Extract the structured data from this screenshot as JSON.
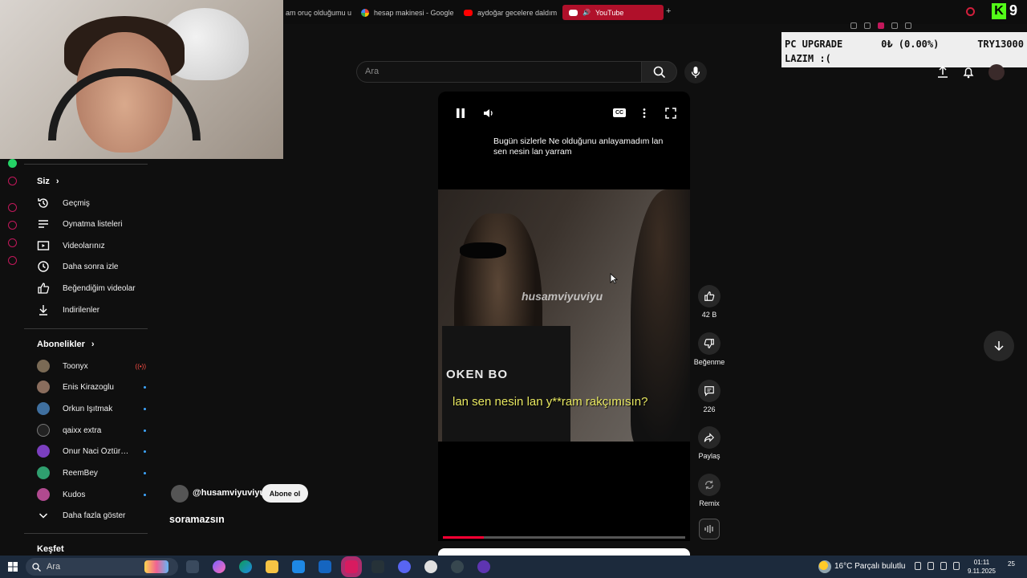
{
  "browser": {
    "tabs": [
      {
        "label": "am oruç olduğumu un",
        "icon": "tab-icon"
      },
      {
        "label": "hesap makinesi - Google",
        "icon": "google-icon"
      },
      {
        "label": "aydoğar gecelere daldım",
        "icon": "youtube-icon"
      },
      {
        "label": "YouTube",
        "icon": "youtube-icon",
        "active": true
      }
    ],
    "new_tab": "+",
    "kick_count": "9"
  },
  "donation": {
    "line1_left": "PC UPGRADE",
    "line1_mid": "0₺ (0.00%)",
    "line1_right": "TRY13000",
    "line2": "LAZIM :("
  },
  "search": {
    "placeholder": "Ara"
  },
  "sidebar": {
    "you": {
      "heading": "Siz",
      "items": [
        {
          "label": "Geçmiş",
          "icon": "history-icon"
        },
        {
          "label": "Oynatma listeleri",
          "icon": "playlist-icon"
        },
        {
          "label": "Videolarınız",
          "icon": "your-videos-icon"
        },
        {
          "label": "Daha sonra izle",
          "icon": "watch-later-icon"
        },
        {
          "label": "Beğendiğim videolar",
          "icon": "like-icon"
        },
        {
          "label": "İndirilenler",
          "icon": "download-icon"
        }
      ]
    },
    "subscriptions": {
      "heading": "Abonelikler",
      "items": [
        {
          "label": "Toonyx",
          "badge": "live",
          "color": "#7a6a55"
        },
        {
          "label": "Enis Kirazoglu",
          "badge": "dot",
          "color": "#8a6d5d"
        },
        {
          "label": "Orkun Işıtmak",
          "badge": "dot",
          "color": "#3f6f9f"
        },
        {
          "label": "qaixx extra",
          "badge": "dot",
          "color": "#222222"
        },
        {
          "label": "Onur Naci Öztürk...",
          "badge": "dot",
          "color": "#7b3fbf"
        },
        {
          "label": "ReemBey",
          "badge": "dot",
          "color": "#2f9f6f"
        },
        {
          "label": "Kudos",
          "badge": "dot",
          "color": "#b04a8f"
        }
      ],
      "show_more": "Daha fazla göster"
    },
    "explore_heading": "Keşfet"
  },
  "player": {
    "caption_top": "Bugün sizlerle Ne olduğunu anlayamadım lan sen nesin lan yarram",
    "cc_label": "CC",
    "watermark": "husamviyuviyu",
    "shirt_text": "OKEN BO",
    "subtitle": "lan sen nesin lan y**ram rakçımısın?",
    "progress_fraction": 0.17
  },
  "channel": {
    "handle": "@husamviyuviyu",
    "subscribe_label": "Abone ol",
    "title": "soramazsın"
  },
  "actions": {
    "likes": "42 B",
    "dislike_label": "Beğenme",
    "comments": "226",
    "share_label": "Paylaş",
    "remix_label": "Remix"
  },
  "taskbar": {
    "search_placeholder": "Ara",
    "weather": "16°C  Parçalı bulutlu",
    "time": "01:11",
    "date": "9.11.2025",
    "notifications": "25"
  },
  "colors": {
    "accent_red": "#ff0033",
    "tab_active": "#b0102a",
    "kick_green": "#53fc18"
  }
}
